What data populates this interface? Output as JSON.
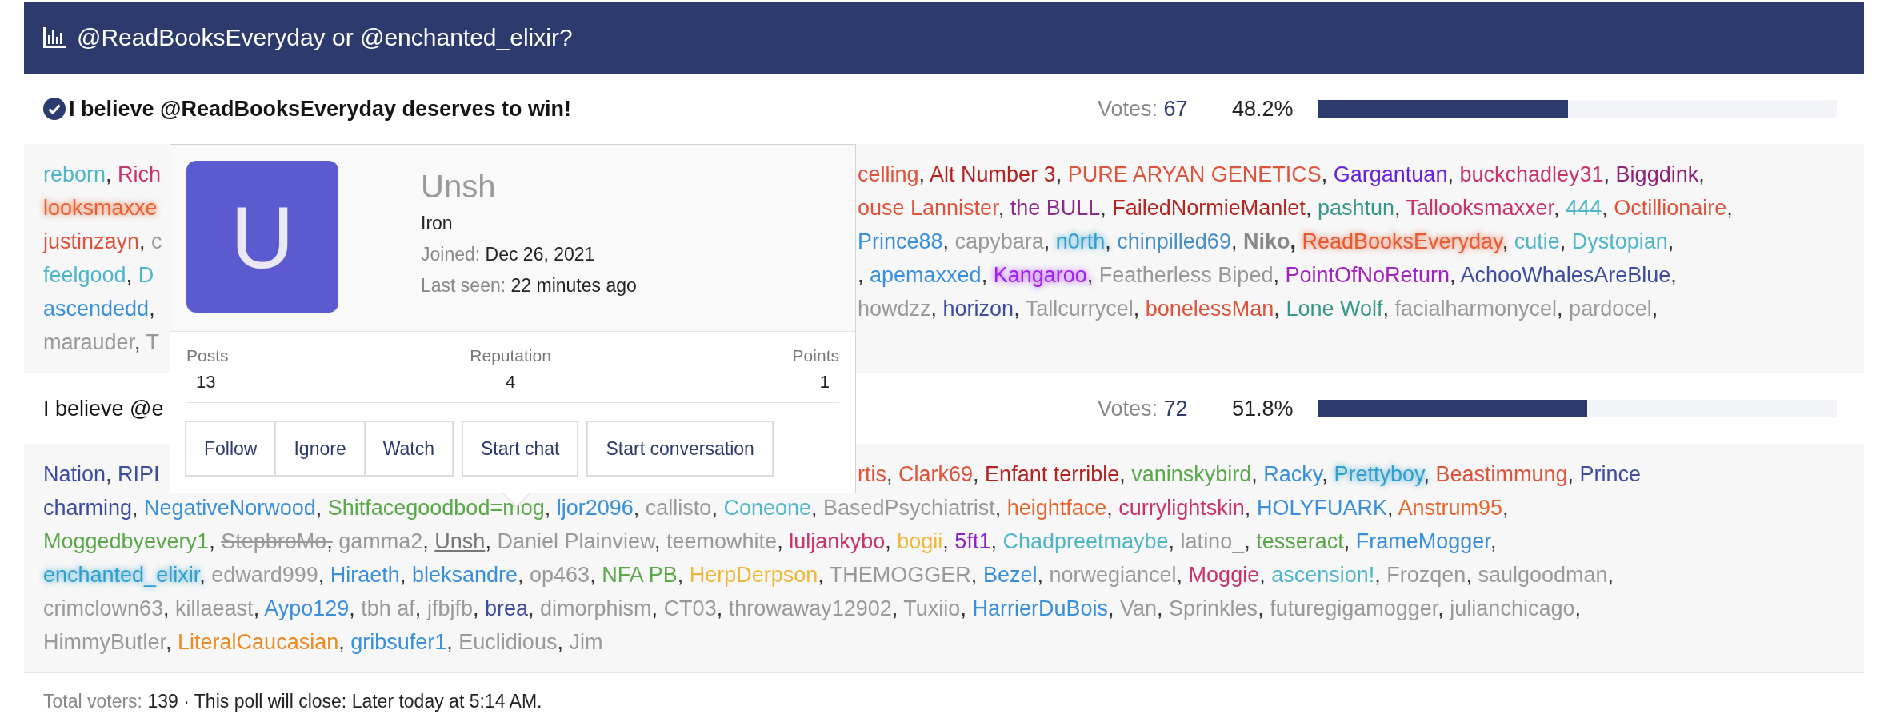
{
  "poll": {
    "title": "@ReadBooksEveryday or @enchanted_elixir?",
    "options": [
      {
        "text": "I believe @ReadBooksEveryday deserves to win!",
        "selected": true,
        "votes_label": "Votes:",
        "votes": "67",
        "percent": "48.2%",
        "level": 0.482,
        "voter_lines": [
          {
            "left": [
              {
                "name": "reborn",
                "color": "#4fb6c9",
                "kind": "plain",
                "punct": ","
              },
              {
                "name": "Rich",
                "color": "#c9336a",
                "kind": "plain"
              }
            ],
            "right": [
              {
                "name": "celling",
                "color": "#e0533b",
                "kind": "plain",
                "punct": ","
              },
              {
                "name": "Alt Number 3",
                "color": "#b3231f",
                "kind": "plain",
                "punct": ","
              },
              {
                "name": "PURE ARYAN GENETICS",
                "color": "#e0533b",
                "kind": "plain",
                "punct": ","
              },
              {
                "name": "Gargantuan",
                "color": "#6a1fe0",
                "kind": "plain",
                "punct": ","
              },
              {
                "name": "buckchadley31",
                "color": "#c9336a",
                "kind": "plain",
                "punct": ","
              },
              {
                "name": "Biggdink",
                "color": "#8e1f7a",
                "kind": "plain",
                "punct": ","
              }
            ]
          },
          {
            "left": [
              {
                "name": "looksmaxxe",
                "color": "#e8602e",
                "kind": "glow"
              }
            ],
            "right": [
              {
                "name": "ouse Lannister",
                "color": "#e0533b",
                "kind": "plain",
                "punct": ","
              },
              {
                "name": "the BULL",
                "color": "#8e2c8e",
                "kind": "plain",
                "punct": ","
              },
              {
                "name": "FailedNormieManlet",
                "color": "#b3231f",
                "kind": "plain",
                "punct": ","
              },
              {
                "name": "pashtun",
                "color": "#36978a",
                "kind": "plain",
                "punct": ","
              },
              {
                "name": "Tallooksmaxxer",
                "color": "#c9336a",
                "kind": "plain",
                "punct": ","
              },
              {
                "name": "444",
                "color": "#4fb6c9",
                "kind": "plain",
                "punct": ","
              },
              {
                "name": "Octillionaire",
                "color": "#e0533b",
                "kind": "plain",
                "punct": ","
              }
            ]
          },
          {
            "left": [
              {
                "name": "justinzayn",
                "color": "#e0533b",
                "kind": "plain",
                "punct": ","
              },
              {
                "name": "c",
                "color": "#999999",
                "kind": "plain"
              }
            ],
            "right": [
              {
                "name": "Prince88",
                "color": "#3a8fdc",
                "kind": "plain",
                "punct": ","
              },
              {
                "name": "capybara",
                "color": "#999999",
                "kind": "plain",
                "punct": ","
              },
              {
                "name": "n0rth",
                "color": "#2f9fd0",
                "kind": "glow",
                "punct": ","
              },
              {
                "name": "chinpilled69",
                "color": "#4a90c8",
                "kind": "plain",
                "punct": ","
              },
              {
                "name": "Niko",
                "color": "#888888",
                "kind": "bold",
                "punct": ","
              },
              {
                "name": "ReadBooksEveryday",
                "color": "#e85a30",
                "kind": "glow",
                "punct": ","
              },
              {
                "name": "cutie",
                "color": "#4fb6c9",
                "kind": "plain",
                "punct": ","
              },
              {
                "name": "Dystopian",
                "color": "#4fb6c9",
                "kind": "plain",
                "punct": ","
              }
            ]
          },
          {
            "left": [
              {
                "name": "feelgood",
                "color": "#4fb6c9",
                "kind": "plain",
                "punct": ","
              },
              {
                "name": "D",
                "color": "#4fb6c9",
                "kind": "plain"
              }
            ],
            "lead": ",",
            "right": [
              {
                "name": "apemaxxed",
                "color": "#3a8fdc",
                "kind": "plain",
                "punct": ","
              },
              {
                "name": "Kangaroo",
                "color": "#a020f0",
                "kind": "glow",
                "punct": ","
              },
              {
                "name": "Featherless Biped",
                "color": "#999999",
                "kind": "plain",
                "punct": ","
              },
              {
                "name": "PointOfNoReturn",
                "color": "#a020c0",
                "kind": "plain",
                "punct": ","
              },
              {
                "name": "AchooWhalesAreBlue",
                "color": "#3e4ca0",
                "kind": "plain",
                "punct": ","
              }
            ]
          },
          {
            "left": [
              {
                "name": "ascendedd",
                "color": "#3a8fdc",
                "kind": "plain",
                "punct": ","
              }
            ],
            "right": [
              {
                "name": "howdzz",
                "color": "#999999",
                "kind": "plain",
                "punct": ","
              },
              {
                "name": "horizon",
                "color": "#3e4ca0",
                "kind": "plain",
                "punct": ","
              },
              {
                "name": "Tallcurrycel",
                "color": "#999999",
                "kind": "plain",
                "punct": ","
              },
              {
                "name": "bonelessMan",
                "color": "#e0533b",
                "kind": "plain",
                "punct": ","
              },
              {
                "name": "Lone Wolf",
                "color": "#36978a",
                "kind": "plain",
                "punct": ","
              },
              {
                "name": "facialharmonycel",
                "color": "#999999",
                "kind": "plain",
                "punct": ","
              },
              {
                "name": "pardocel",
                "color": "#999999",
                "kind": "plain",
                "punct": ","
              }
            ]
          },
          {
            "left": [
              {
                "name": "marauder",
                "color": "#999999",
                "kind": "plain",
                "punct": ","
              },
              {
                "name": "T",
                "color": "#999999",
                "kind": "plain"
              }
            ]
          }
        ]
      },
      {
        "text": "I believe @e",
        "selected": false,
        "votes_label": "Votes:",
        "votes": "72",
        "percent": "51.8%",
        "level": 0.518,
        "voter_lines": [
          {
            "left": [
              {
                "name": "Nation",
                "color": "#3e4ca0",
                "kind": "plain",
                "punct": ","
              },
              {
                "name": "RIPI",
                "color": "#3e4ca0",
                "kind": "plain"
              }
            ],
            "right": [
              {
                "name": "rtis",
                "color": "#e0533b",
                "kind": "plain",
                "punct": ","
              },
              {
                "name": "Clark69",
                "color": "#e0533b",
                "kind": "plain",
                "punct": ","
              },
              {
                "name": "Enfant terrible",
                "color": "#b3231f",
                "kind": "plain",
                "punct": ","
              },
              {
                "name": "vaninskybird",
                "color": "#5aa84a",
                "kind": "plain",
                "punct": ","
              },
              {
                "name": "Racky",
                "color": "#3a8fdc",
                "kind": "plain",
                "punct": ","
              },
              {
                "name": "Prettyboy",
                "color": "#2f9fd0",
                "kind": "glow",
                "punct": ","
              },
              {
                "name": "Beastimmung",
                "color": "#e0533b",
                "kind": "plain",
                "punct": ","
              },
              {
                "name": "Prince",
                "color": "#3e4ca0",
                "kind": "plain"
              }
            ]
          },
          {
            "left": [
              {
                "name": "charming",
                "color": "#3e4ca0",
                "kind": "plain",
                "punct": ","
              },
              {
                "name": "NegativeNorwood",
                "color": "#3a8fdc",
                "kind": "plain",
                "punct": ","
              },
              {
                "name": "Shitfacegoodbod=mog",
                "color": "#5aa84a",
                "kind": "plain",
                "punct": ","
              },
              {
                "name": "ljor2096",
                "color": "#3a8fdc",
                "kind": "plain",
                "punct": ","
              },
              {
                "name": "callisto",
                "color": "#999999",
                "kind": "plain",
                "punct": ","
              },
              {
                "name": "Coneone",
                "color": "#4fb6c9",
                "kind": "plain",
                "punct": ","
              },
              {
                "name": "BasedPsychiatrist",
                "color": "#999999",
                "kind": "plain",
                "punct": ","
              },
              {
                "name": "heightface",
                "color": "#e8672e",
                "kind": "plain",
                "punct": ","
              },
              {
                "name": "currylightskin",
                "color": "#c9336a",
                "kind": "plain",
                "punct": ","
              },
              {
                "name": "HOLYFUARK",
                "color": "#3a8fdc",
                "kind": "plain",
                "punct": ","
              },
              {
                "name": "Anstrum95",
                "color": "#e8672e",
                "kind": "plain",
                "punct": ","
              }
            ]
          },
          {
            "left": [
              {
                "name": "Moggedbyevery1",
                "color": "#5aa84a",
                "kind": "plain",
                "punct": ","
              },
              {
                "name": "StepbroMo",
                "color": "#999999",
                "kind": "strike",
                "punct": ","
              },
              {
                "name": "gamma2",
                "color": "#999999",
                "kind": "plain",
                "punct": ","
              },
              {
                "name": "Unsh",
                "color": "#777777",
                "kind": "underline",
                "punct": ","
              },
              {
                "name": "Daniel Plainview",
                "color": "#999999",
                "kind": "plain",
                "punct": ","
              },
              {
                "name": "teemowhite",
                "color": "#999999",
                "kind": "plain",
                "punct": ","
              },
              {
                "name": "luljankybo",
                "color": "#c9336a",
                "kind": "plain",
                "punct": ","
              },
              {
                "name": "bogii",
                "color": "#f0b83a",
                "kind": "plain",
                "punct": ","
              },
              {
                "name": "5ft1",
                "color": "#8a1fd0",
                "kind": "plain",
                "punct": ","
              },
              {
                "name": "Chadpreetmaybe",
                "color": "#4fb6c9",
                "kind": "plain",
                "punct": ","
              },
              {
                "name": "latino_",
                "color": "#999999",
                "kind": "plain",
                "punct": ","
              },
              {
                "name": "tesseract",
                "color": "#5aa84a",
                "kind": "plain",
                "punct": ","
              },
              {
                "name": "FrameMogger",
                "color": "#3a8fdc",
                "kind": "plain",
                "punct": ","
              }
            ]
          },
          {
            "left": [
              {
                "name": "enchanted_elixir",
                "color": "#2f9fd0",
                "kind": "glow",
                "punct": ","
              },
              {
                "name": "edward999",
                "color": "#999999",
                "kind": "plain",
                "punct": ","
              },
              {
                "name": "Hiraeth",
                "color": "#3a8fdc",
                "kind": "plain",
                "punct": ","
              },
              {
                "name": "bleksandre",
                "color": "#3a8fdc",
                "kind": "plain",
                "punct": ","
              },
              {
                "name": "op463",
                "color": "#999999",
                "kind": "plain",
                "punct": ","
              },
              {
                "name": "NFA PB",
                "color": "#5aa84a",
                "kind": "plain",
                "punct": ","
              },
              {
                "name": "HerpDerpson",
                "color": "#f0b83a",
                "kind": "plain",
                "punct": ","
              },
              {
                "name": "THEMOGGER",
                "color": "#999999",
                "kind": "plain",
                "punct": ","
              },
              {
                "name": "Bezel",
                "color": "#3a8fdc",
                "kind": "plain",
                "punct": ","
              },
              {
                "name": "norwegiancel",
                "color": "#999999",
                "kind": "plain",
                "punct": ","
              },
              {
                "name": "Moggie",
                "color": "#c9336a",
                "kind": "plain",
                "punct": ","
              },
              {
                "name": "ascension!",
                "color": "#4fb6c9",
                "kind": "plain",
                "punct": ","
              },
              {
                "name": "Frozqen",
                "color": "#999999",
                "kind": "plain",
                "punct": ","
              },
              {
                "name": "saulgoodman",
                "color": "#999999",
                "kind": "plain",
                "punct": ","
              }
            ]
          },
          {
            "left": [
              {
                "name": "crimclown63",
                "color": "#999999",
                "kind": "plain",
                "punct": ","
              },
              {
                "name": "killaeast",
                "color": "#999999",
                "kind": "plain",
                "punct": ","
              },
              {
                "name": "Aypo129",
                "color": "#3a8fdc",
                "kind": "plain",
                "punct": ","
              },
              {
                "name": "tbh af",
                "color": "#999999",
                "kind": "plain",
                "punct": ","
              },
              {
                "name": "jfbjfb",
                "color": "#999999",
                "kind": "plain",
                "punct": ","
              },
              {
                "name": "brea",
                "color": "#3e4ca0",
                "kind": "plain",
                "punct": ","
              },
              {
                "name": "dimorphism",
                "color": "#999999",
                "kind": "plain",
                "punct": ","
              },
              {
                "name": "CT03",
                "color": "#999999",
                "kind": "plain",
                "punct": ","
              },
              {
                "name": "throwaway12902",
                "color": "#999999",
                "kind": "plain",
                "punct": ","
              },
              {
                "name": "Tuxiio",
                "color": "#999999",
                "kind": "plain",
                "punct": ","
              },
              {
                "name": "HarrierDuBois",
                "color": "#3a8fdc",
                "kind": "plain",
                "punct": ","
              },
              {
                "name": "Van",
                "color": "#999999",
                "kind": "plain",
                "punct": ","
              },
              {
                "name": "Sprinkles",
                "color": "#999999",
                "kind": "plain",
                "punct": ","
              },
              {
                "name": "futuregigamogger",
                "color": "#999999",
                "kind": "plain",
                "punct": ","
              },
              {
                "name": "julianchicago",
                "color": "#999999",
                "kind": "plain",
                "punct": ","
              }
            ]
          },
          {
            "left": [
              {
                "name": "HimmyButler",
                "color": "#999999",
                "kind": "plain",
                "punct": ","
              },
              {
                "name": "LiteralCaucasian",
                "color": "#ee8a20",
                "kind": "plain",
                "punct": ","
              },
              {
                "name": "gribsufer1",
                "color": "#3a8fdc",
                "kind": "plain",
                "punct": ","
              },
              {
                "name": "Euclidious",
                "color": "#999999",
                "kind": "plain",
                "punct": ","
              },
              {
                "name": "Jim",
                "color": "#999999",
                "kind": "plain"
              }
            ]
          }
        ]
      }
    ],
    "footer": {
      "label": "Total voters:",
      "count": "139",
      "close_text": "· This poll will close: Later today at 5:14 AM."
    }
  },
  "member_card": {
    "avatar_letter": "U",
    "name": "Unsh",
    "rank": "Iron",
    "facts": [
      {
        "label": "Joined:",
        "value": "Dec 26, 2021"
      },
      {
        "label": "Last seen:",
        "value": "22 minutes ago"
      }
    ],
    "stats": [
      {
        "label": "Posts",
        "value": "13"
      },
      {
        "label": "Reputation",
        "value": "4"
      },
      {
        "label": "Points",
        "value": "1"
      }
    ],
    "button_groups": [
      {
        "buttons": [
          "Follow",
          "Ignore",
          "Watch"
        ]
      },
      {
        "buttons": [
          "Start chat"
        ]
      },
      {
        "buttons": [
          "Start conversation"
        ]
      }
    ]
  }
}
